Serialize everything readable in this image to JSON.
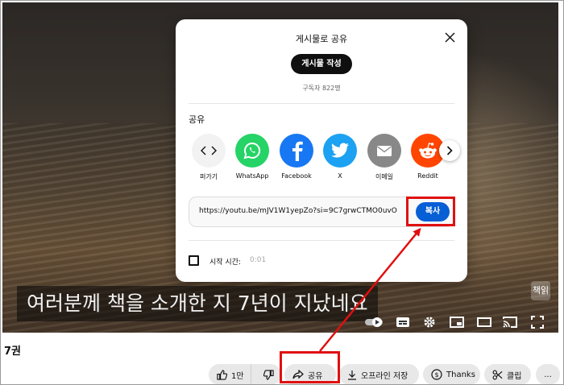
{
  "modal": {
    "title": "게시물로 공유",
    "post_button": "게시물 작성",
    "subscribers": "구독자 822명",
    "share_section_label": "공유",
    "share_targets": [
      {
        "label": "퍼가기",
        "icon": "embed-icon",
        "color": "#f2f2f2"
      },
      {
        "label": "WhatsApp",
        "icon": "whatsapp-icon",
        "color": "#25d366"
      },
      {
        "label": "Facebook",
        "icon": "facebook-icon",
        "color": "#1877f2"
      },
      {
        "label": "X",
        "icon": "twitter-bird-icon",
        "color": "#1da1f2"
      },
      {
        "label": "이메일",
        "icon": "email-icon",
        "color": "#888888"
      },
      {
        "label": "Reddit",
        "icon": "reddit-icon",
        "color": "#ff4500"
      }
    ],
    "share_url": "https://youtu.be/mJV1W1yepZo?si=9C7grwCTMO0uvO",
    "copy_button": "복사",
    "start_time_label": "시작 시간:",
    "start_time_value": "0:01"
  },
  "video": {
    "caption": "여러분께 책을 소개한 지 7년이 지났네요",
    "watermark": "책읽"
  },
  "below_video": {
    "title": "7권",
    "like_count": "1만",
    "share_label": "공유",
    "offline_save_label": "오프라인 저장",
    "thanks_label": "Thanks",
    "clip_label": "클립",
    "more_label": "..."
  },
  "colors": {
    "accent_blue": "#065fd4",
    "highlight_red": "#e01010"
  }
}
